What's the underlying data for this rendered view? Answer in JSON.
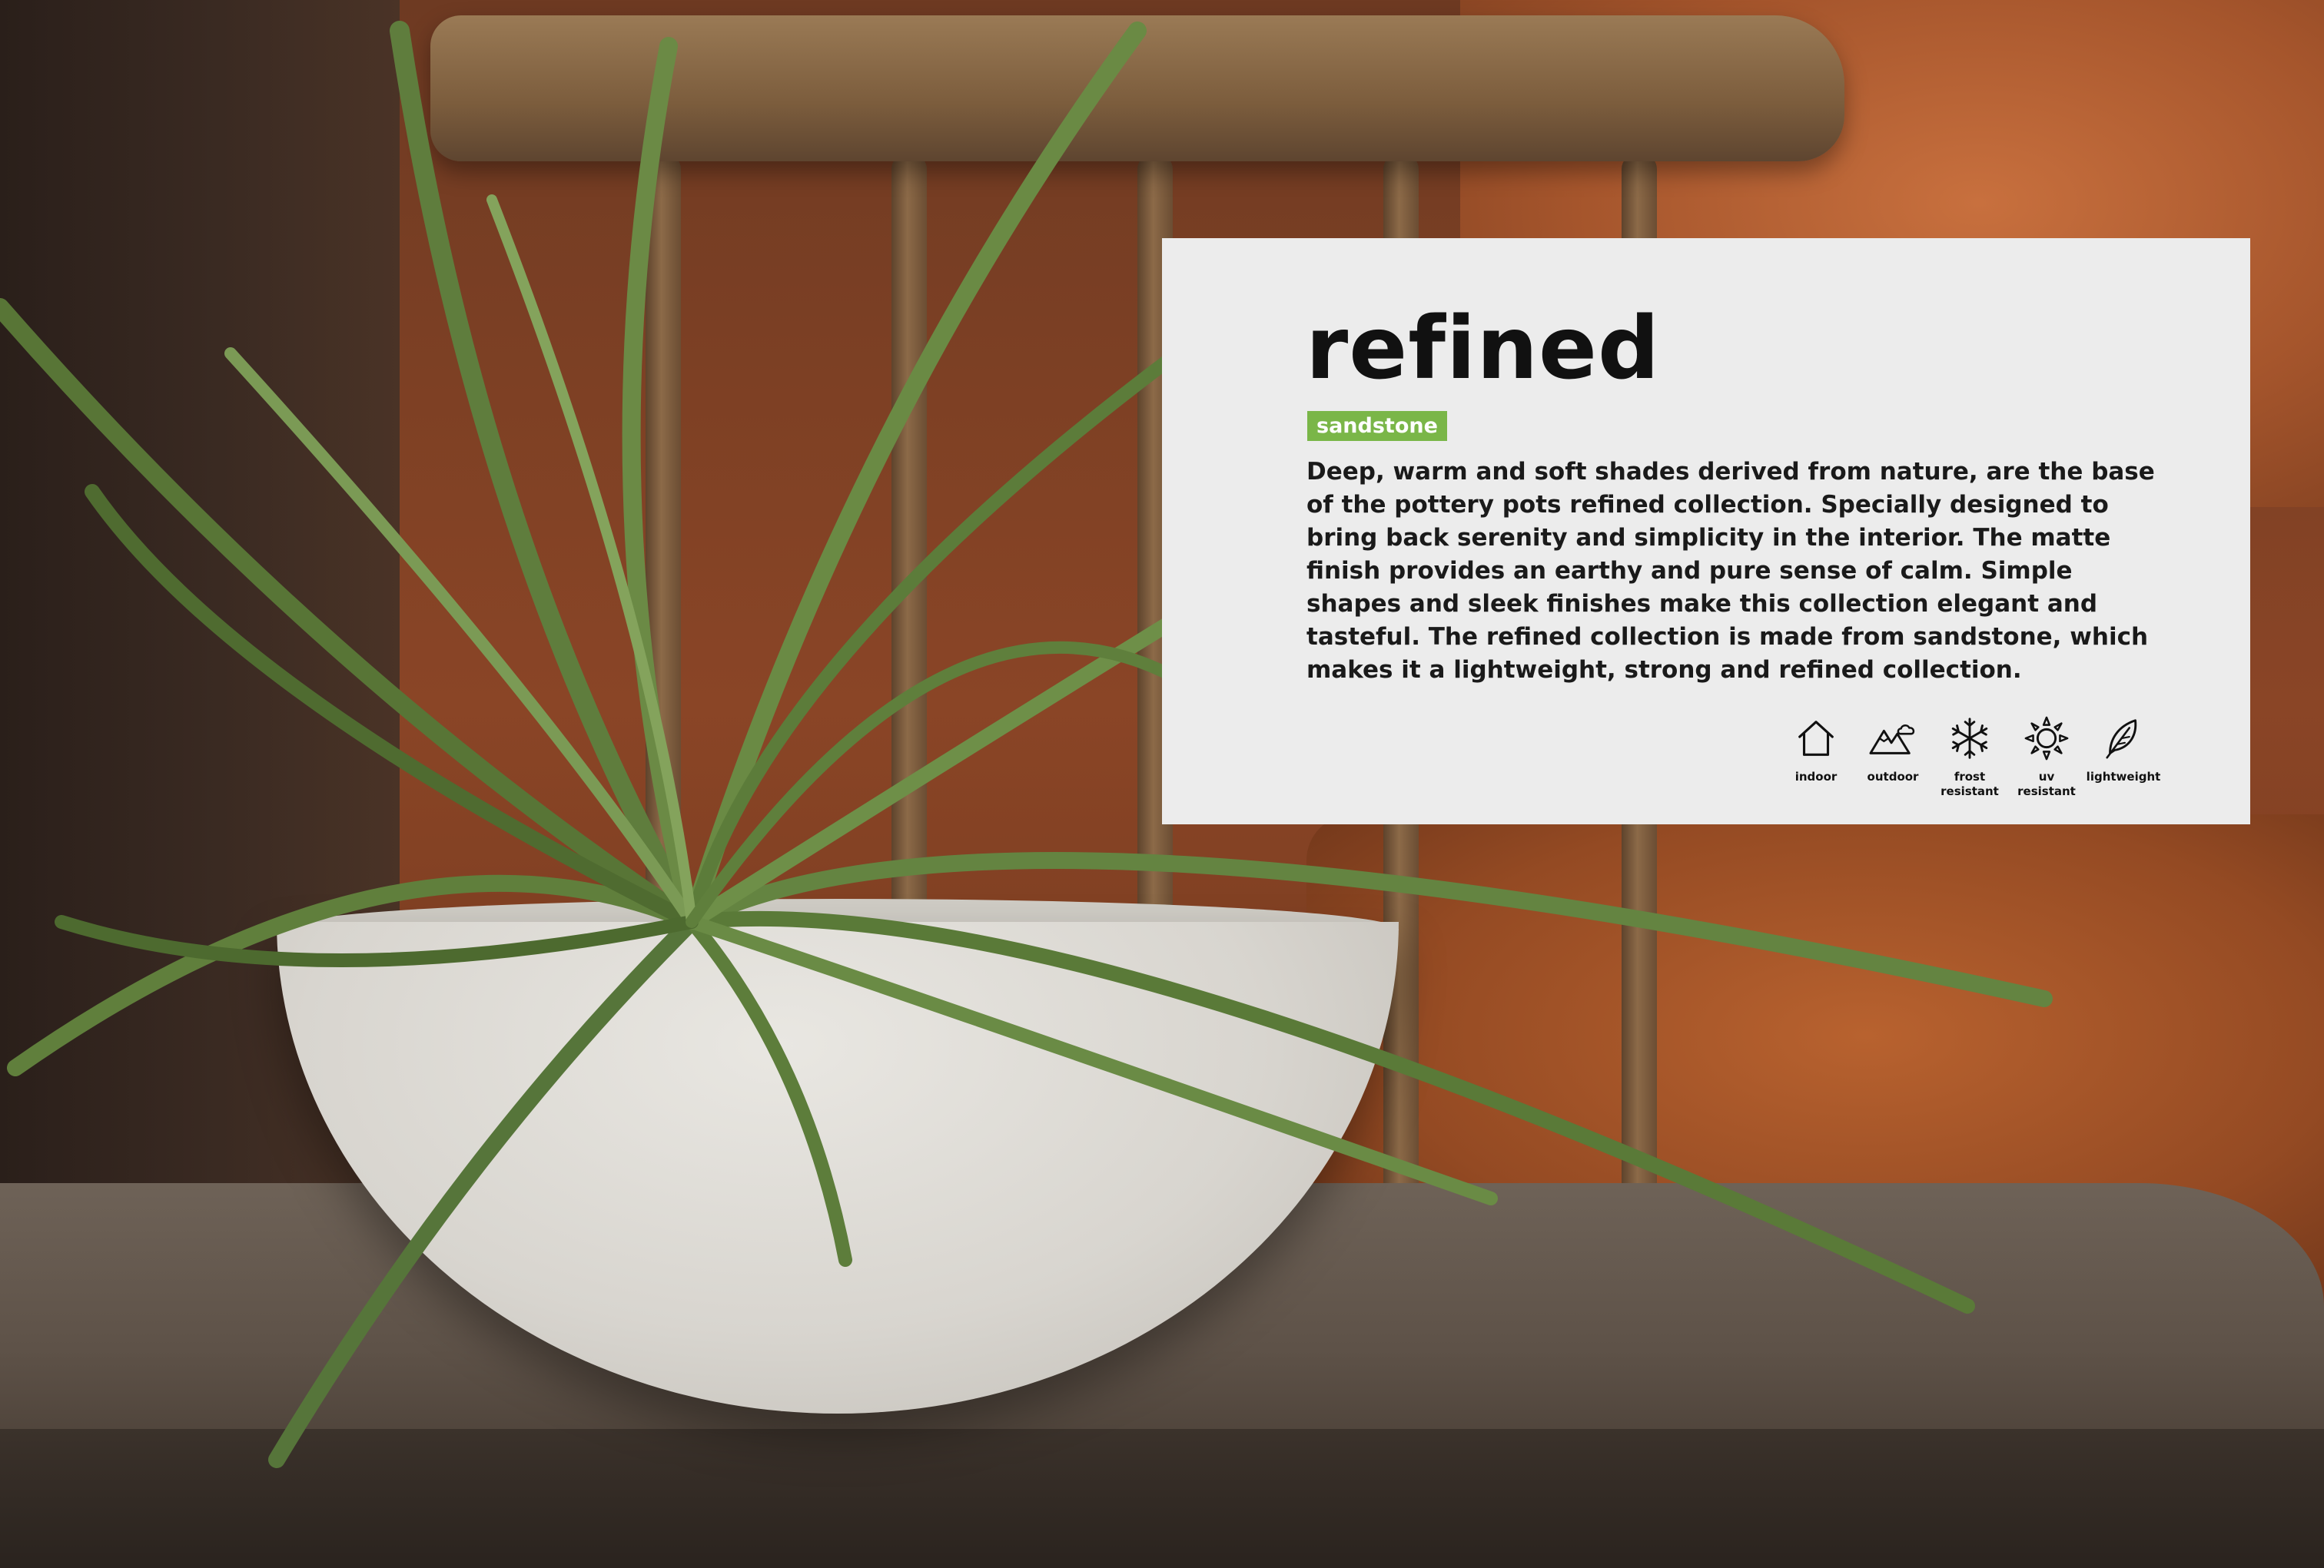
{
  "card": {
    "title": "refined",
    "badge": "sandstone",
    "description": "Deep, warm and soft shades derived from nature, are the base of the pottery pots refined collection. Specially designed to bring back serenity and simplicity in the interior. The matte finish provides an earthy and pure sense of calm. Simple shapes and sleek finishes make this collection elegant and tasteful. The refined collection is made from sandstone, which makes it a lightweight, strong and refined collection."
  },
  "features": [
    {
      "icon": "house-icon",
      "label": "indoor"
    },
    {
      "icon": "mountain-cloud-icon",
      "label": "outdoor"
    },
    {
      "icon": "snowflake-icon",
      "label": "frost\nresistant"
    },
    {
      "icon": "sun-icon",
      "label": "uv\nresistant"
    },
    {
      "icon": "feather-icon",
      "label": "lightweight"
    }
  ],
  "colors": {
    "card_background": "#ececec",
    "badge_background": "#7ab648",
    "text": "#111111"
  }
}
